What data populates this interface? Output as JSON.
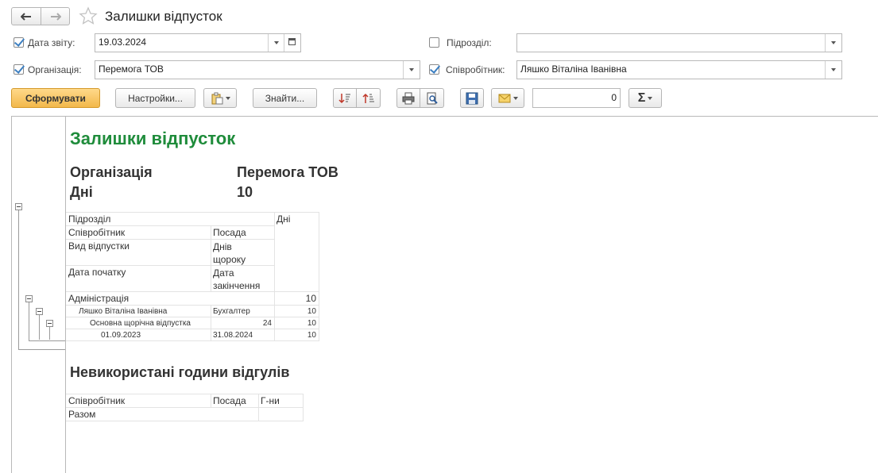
{
  "window": {
    "title": "Залишки відпусток"
  },
  "filters": {
    "report_date_label": "Дата звіту:",
    "report_date_value": "19.03.2024",
    "department_label": "Підрозділ:",
    "department_value": "",
    "organization_label": "Організація:",
    "organization_value": "Перемога ТОВ",
    "employee_label": "Співробітник:",
    "employee_value": "Ляшко Віталіна Іванівна",
    "report_date_checked": true,
    "department_checked": false,
    "organization_checked": true,
    "employee_checked": true
  },
  "toolbar": {
    "generate_label": "Сформувати",
    "settings_label": "Настройки...",
    "find_label": "Знайти...",
    "sum_value": "0",
    "sum_symbol": "Σ"
  },
  "report": {
    "title": "Залишки відпусток",
    "org_label": "Організація",
    "org_value": "Перемога ТОВ",
    "days_label": "Дні",
    "days_value": "10",
    "table": {
      "headers": {
        "department": "Підрозділ",
        "days": "Дні",
        "employee": "Співробітник",
        "position": "Посада",
        "leave_type": "Вид відпустки",
        "annual_days": "Днів щороку",
        "start_date": "Дата початку",
        "end_date": "Дата закінчення"
      },
      "group": {
        "department": "Адміністрація",
        "days": "10"
      },
      "employee_row": {
        "name": "Ляшко Віталіна Іванівна",
        "position": "Бухгалтер",
        "days": "10"
      },
      "leave_row": {
        "type": "Основна щорічна відпустка",
        "annual": "24",
        "days": "10"
      },
      "period_row": {
        "start": "01.09.2023",
        "end": "31.08.2024",
        "days": "10"
      }
    },
    "section2_title": "Невикористані години відгулів",
    "table2": {
      "headers": {
        "employee": "Співробітник",
        "position": "Посада",
        "hours": "Г-ни"
      },
      "total_label": "Разом"
    }
  },
  "colors": {
    "accent_green": "#1f8c3b",
    "generate_button": "#f5c15a"
  }
}
